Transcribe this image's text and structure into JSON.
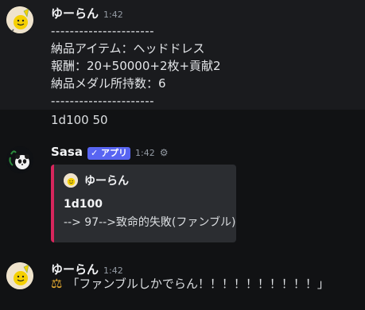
{
  "messages": [
    {
      "author": "ゆーらん",
      "time": "1:42",
      "lines": [
        "----------------------",
        "納品アイテム：ヘッドドレス",
        "報酬：20+50000+2枚+貢献2",
        "納品メダル所持数：6",
        "----------------------"
      ],
      "avatar_icon": "smiley-avatar-icon"
    },
    {
      "text": "1d100 50"
    },
    {
      "author": "Sasa",
      "badge": "✓ アプリ",
      "time": "1:42",
      "avatar_icon": "panda-avatar-icon",
      "embed": {
        "author": "ゆーらん",
        "title": "1d100",
        "description": "--> 97-->致命的失敗(ファンブル)",
        "accent_color": "#d7265c"
      }
    },
    {
      "author": "ゆーらん",
      "time": "1:42",
      "content": "「ファンブルしかでらん！！！！！！！！！！」",
      "icon": "scale-icon"
    }
  ]
}
